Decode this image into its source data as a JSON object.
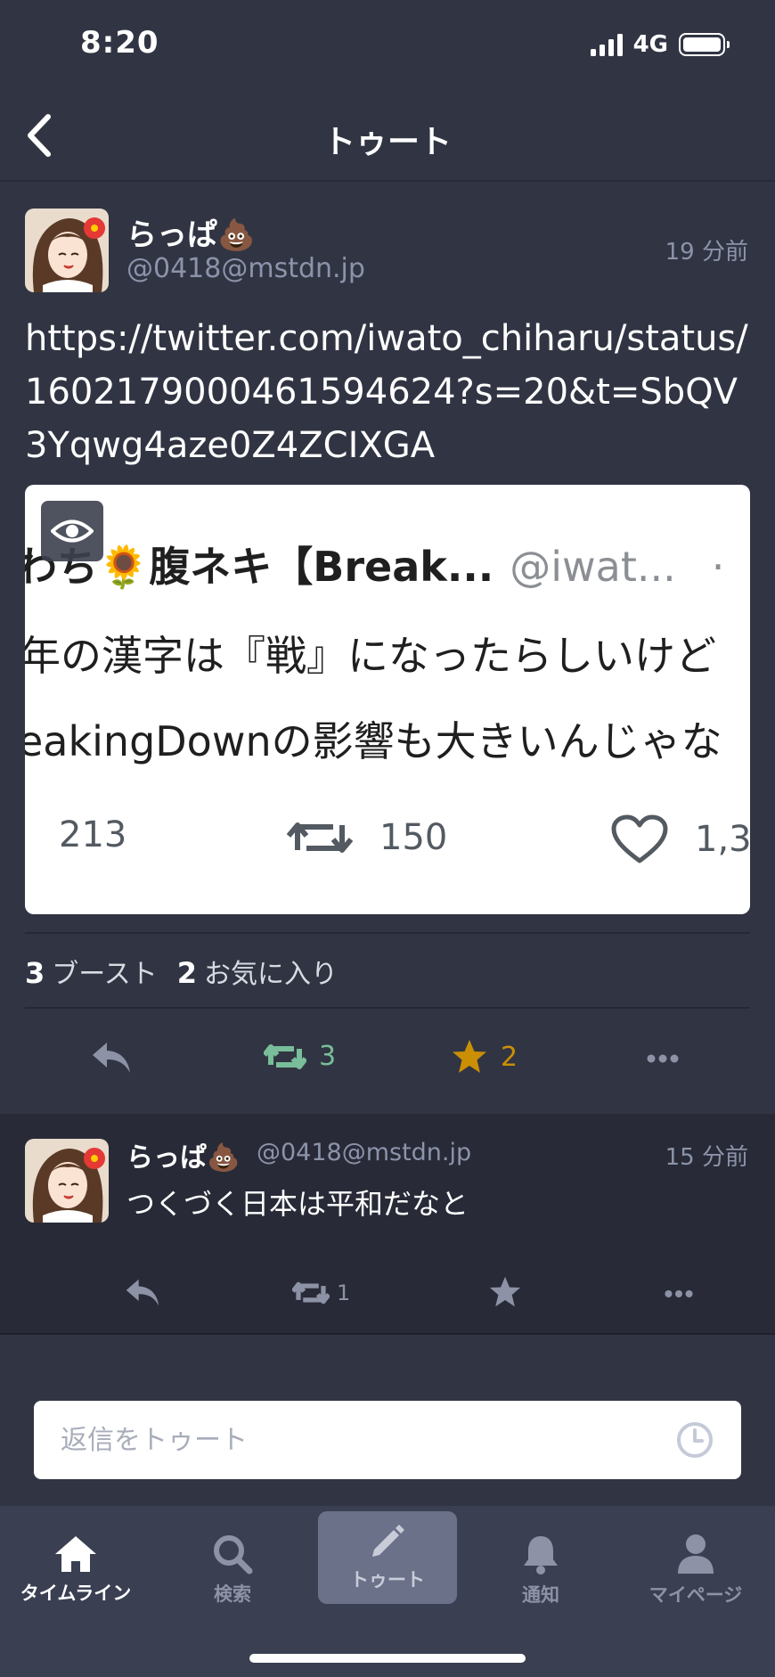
{
  "status_bar": {
    "time": "8:20",
    "network": "4G"
  },
  "nav": {
    "title": "トゥート",
    "back_icon": "chevron-left-icon"
  },
  "main_toot": {
    "display_name": "らっぱ💩",
    "acct": "@0418@mstdn.jp",
    "time": "19 分前",
    "content": "https://twitter.com/iwato_chiharu/status/1602179000461594624?s=20&t=SbQV3Yqwg4aze0Z4ZCIXGA",
    "media": {
      "line1_name": "わち🌻腹ネキ【Break...",
      "line1_handle": "@iwat...",
      "line1_dot": "·",
      "line2": "年の漢字は『戦』になったらしいけど",
      "line3": "eakingDownの影響も大きいんじゃな",
      "replies": "213",
      "retweets": "150",
      "likes": "1,3"
    },
    "boost_count": "3",
    "boost_label": "ブースト",
    "fav_count": "2",
    "fav_label": "お気に入り",
    "actions": {
      "boost": "3",
      "favourite": "2"
    }
  },
  "reply_toot": {
    "display_name": "らっぱ💩",
    "acct": "@0418@mstdn.jp",
    "time": "15 分前",
    "content": "つくづく日本は平和だなと",
    "actions": {
      "boost": "1"
    }
  },
  "compose": {
    "placeholder": "返信をトゥート"
  },
  "tabs": [
    {
      "label": "タイムライン",
      "icon": "home-icon"
    },
    {
      "label": "検索",
      "icon": "search-icon"
    },
    {
      "label": "トゥート",
      "icon": "pencil-icon"
    },
    {
      "label": "通知",
      "icon": "bell-icon"
    },
    {
      "label": "マイページ",
      "icon": "person-icon"
    }
  ],
  "colors": {
    "background": "#313543",
    "reply_background": "#282b37",
    "boost_active": "#79bd9a",
    "favourite_active": "#ca8f04",
    "muted": "#8c93aa",
    "tab_bar": "#3a3f52"
  }
}
